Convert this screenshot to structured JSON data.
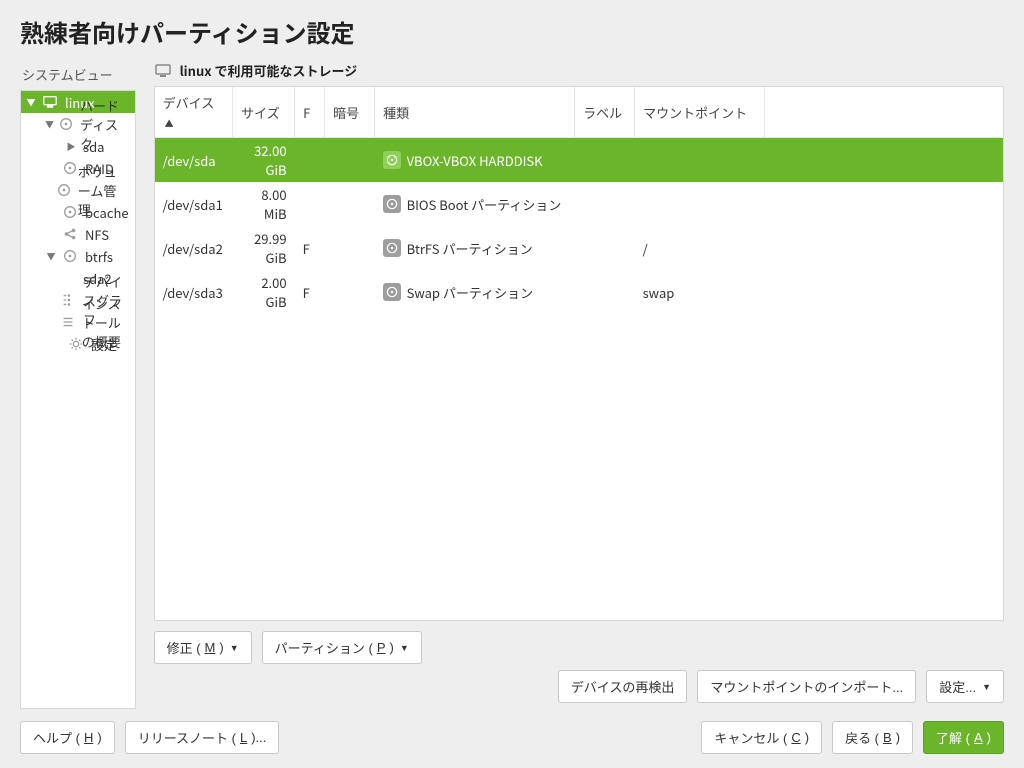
{
  "title": "熟練者向けパーティション設定",
  "system_view_label": "システムビュー",
  "tree": [
    {
      "id": "root",
      "depth": 0,
      "exp": "down",
      "icon": "monitor",
      "label": "linux",
      "sel": true
    },
    {
      "id": "hdd",
      "depth": 1,
      "exp": "down",
      "icon": "disk",
      "label": "ハードディスク"
    },
    {
      "id": "sda",
      "depth": 2,
      "exp": "right",
      "icon": "none",
      "label": "sda"
    },
    {
      "id": "raid",
      "depth": 1,
      "exp": "none",
      "icon": "disk",
      "label": "RAID"
    },
    {
      "id": "vm",
      "depth": 1,
      "exp": "none",
      "icon": "disk",
      "label": "ボリューム管理"
    },
    {
      "id": "bcache",
      "depth": 1,
      "exp": "none",
      "icon": "disk",
      "label": "bcache"
    },
    {
      "id": "nfs",
      "depth": 1,
      "exp": "none",
      "icon": "share",
      "label": "NFS"
    },
    {
      "id": "btrfs",
      "depth": 1,
      "exp": "down",
      "icon": "disk",
      "label": "btrfs"
    },
    {
      "id": "sda2",
      "depth": 2,
      "exp": "none",
      "icon": "none",
      "label": "sda2"
    },
    {
      "id": "devg",
      "depth": 0,
      "exp": "none",
      "icon": "graph",
      "label": "デバイスグラフ",
      "flat": true
    },
    {
      "id": "inst",
      "depth": 0,
      "exp": "none",
      "icon": "list",
      "label": "インストールの概要",
      "flat": true
    },
    {
      "id": "setg",
      "depth": 0,
      "exp": "none",
      "icon": "gear",
      "label": "設定",
      "flat": true
    }
  ],
  "right_header": "linux で利用可能なストレージ",
  "columns": {
    "device": "デバイス",
    "size": "サイズ",
    "f": "F",
    "enc": "暗号",
    "type": "種類",
    "label": "ラベル",
    "mount": "マウントポイント"
  },
  "rows": [
    {
      "device": "/dev/sda",
      "size": "32.00 GiB",
      "f": "",
      "enc": "",
      "type": "VBOX-VBOX HARDDISK",
      "label": "",
      "mount": "",
      "selected": true
    },
    {
      "device": "/dev/sda1",
      "size": "8.00 MiB",
      "f": "",
      "enc": "",
      "type": "BIOS Boot パーティション",
      "label": "",
      "mount": ""
    },
    {
      "device": "/dev/sda2",
      "size": "29.99 GiB",
      "f": "F",
      "enc": "",
      "type": "BtrFS パーティション",
      "label": "",
      "mount": "/"
    },
    {
      "device": "/dev/sda3",
      "size": "2.00 GiB",
      "f": "F",
      "enc": "",
      "type": "Swap パーティション",
      "label": "",
      "mount": "swap"
    }
  ],
  "buttons": {
    "modify": "修正 (",
    "modify_u": "M",
    "modify2": ")",
    "partition": "パーティション (",
    "partition_u": "P",
    "partition2": ")",
    "rescan": "デバイスの再検出",
    "import": "マウントポイントのインポート...",
    "settings": "設定...",
    "help": "ヘルプ (",
    "help_u": "H",
    "help2": ")",
    "relnotes": "リリースノート (",
    "relnotes_u": "L",
    "relnotes2": ")...",
    "cancel": "キャンセル (",
    "cancel_u": "C",
    "cancel2": ")",
    "back": "戻る (",
    "back_u": "B",
    "back2": ")",
    "ok": "了解 (",
    "ok_u": "A",
    "ok2": ")"
  }
}
